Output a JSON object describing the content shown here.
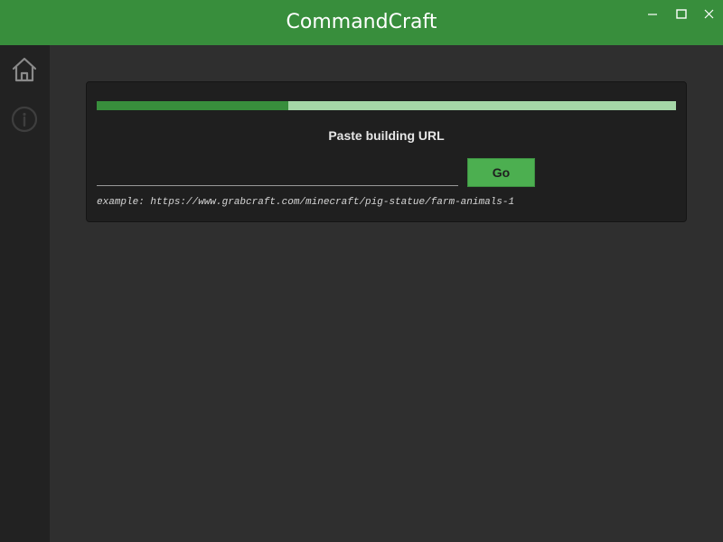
{
  "window": {
    "title": "CommandCraft",
    "controls": [
      "minimize-icon",
      "maximize-icon",
      "close-icon"
    ]
  },
  "sidebar": {
    "items": [
      {
        "icon": "home-icon",
        "active": true
      },
      {
        "icon": "info-icon",
        "active": false
      }
    ]
  },
  "main": {
    "progress": {
      "value": 0.33
    },
    "prompt": "Paste building URL",
    "url_input": {
      "value": "",
      "placeholder": ""
    },
    "go_label": "Go",
    "example": "example: https://www.grabcraft.com/minecraft/pig-statue/farm-animals-1"
  },
  "colors": {
    "titlebar": "#388e3c",
    "sidebar_bg": "#222222",
    "main_bg": "#2f2f2f",
    "card_bg": "#1f1f1f",
    "progress_fill": "#388e3c",
    "progress_track": "#a5d6a7",
    "button": "#4caf50"
  }
}
